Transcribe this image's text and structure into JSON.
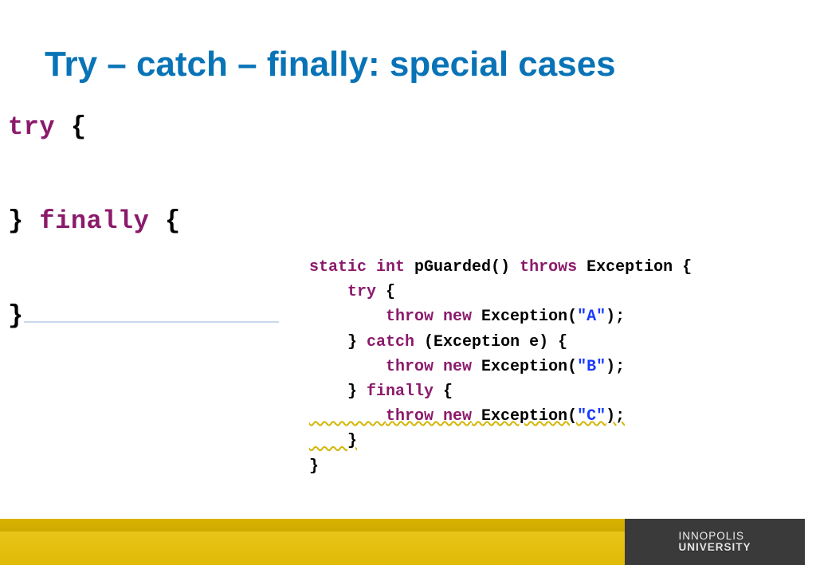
{
  "title": "Try – catch – finally: special cases",
  "code_left": {
    "l1_kw": "try",
    "l1_brace": " {",
    "l2": "",
    "l3_close": "} ",
    "l3_kw": "finally",
    "l3_brace": " {",
    "l4": "",
    "l5_close": "}"
  },
  "code_right": {
    "l1_pre": "static int",
    "l1_mid": " pGuarded() ",
    "l1_throws": "throws",
    "l1_post": " Exception {",
    "l2_indent": "    ",
    "l2_kw": "try",
    "l2_brace": " {",
    "l3_indent": "        ",
    "l3_kw": "throw new",
    "l3_mid": " Exception(",
    "l3_str": "\"A\"",
    "l3_end": ");",
    "l4_indent": "    ",
    "l4_close": "} ",
    "l4_kw": "catch",
    "l4_mid": " (Exception e) {",
    "l5_indent": "        ",
    "l5_kw": "throw new",
    "l5_mid": " Exception(",
    "l5_str": "\"B\"",
    "l5_end": ");",
    "l6_indent": "    ",
    "l6_close": "} ",
    "l6_kw": "finally",
    "l6_brace": " {",
    "l7_indent": "        ",
    "l7_kw": "throw new",
    "l7_mid": " Exception(",
    "l7_str": "\"C\"",
    "l7_end": ");",
    "l8_indent": "    ",
    "l8_close": "}",
    "l9_close": "}"
  },
  "logo": {
    "line1": "INNOPOLIS",
    "line2": "UNIVERSITY"
  }
}
